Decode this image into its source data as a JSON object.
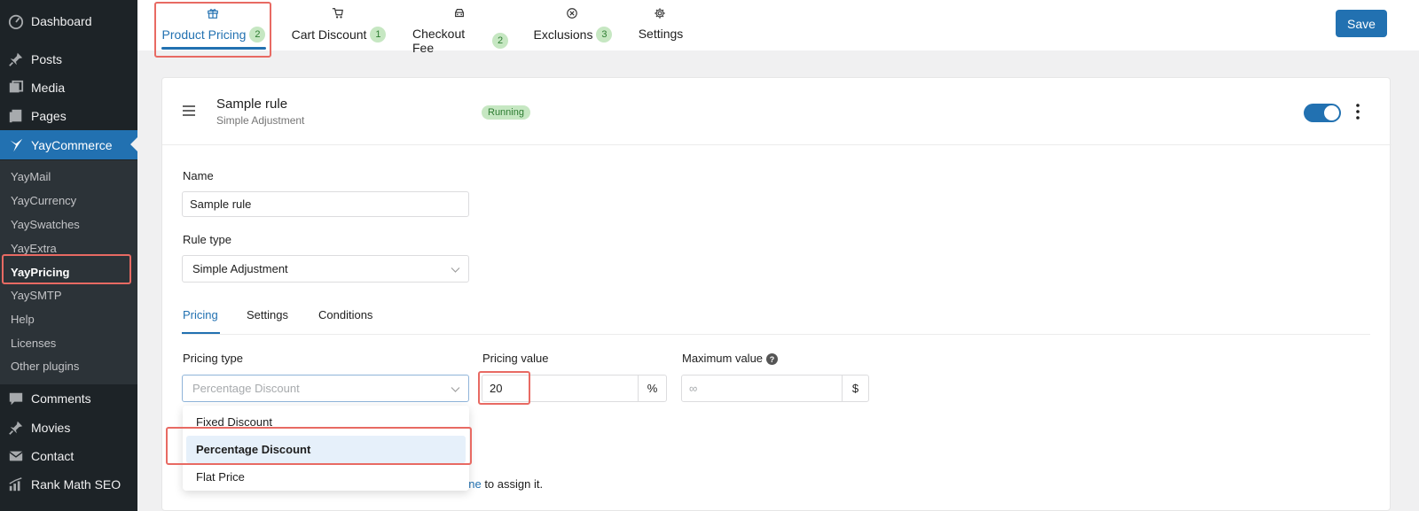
{
  "sidebar": {
    "top_items": [
      {
        "label": "Dashboard",
        "icon": "dashboard-icon"
      },
      {
        "label": "Posts",
        "icon": "pin-icon"
      },
      {
        "label": "Media",
        "icon": "media-icon"
      },
      {
        "label": "Pages",
        "icon": "pages-icon"
      },
      {
        "label": "YayCommerce",
        "icon": "yaycommerce-icon"
      }
    ],
    "submenu": [
      "YayMail",
      "YayCurrency",
      "YaySwatches",
      "YayExtra",
      "YayPricing",
      "YaySMTP",
      "Help",
      "Licenses",
      "Other plugins"
    ],
    "bottom_items": [
      {
        "label": "Comments",
        "icon": "comments-icon"
      },
      {
        "label": "Movies",
        "icon": "pin-icon"
      },
      {
        "label": "Contact",
        "icon": "mail-icon"
      },
      {
        "label": "Rank Math SEO",
        "icon": "chart-icon"
      }
    ]
  },
  "topbar": {
    "tabs": [
      {
        "label": "Product Pricing",
        "badge": "2",
        "icon": "gift-icon"
      },
      {
        "label": "Cart Discount",
        "badge": "1",
        "icon": "cart-icon"
      },
      {
        "label": "Checkout Fee",
        "badge": "2",
        "icon": "car-icon"
      },
      {
        "label": "Exclusions",
        "badge": "3",
        "icon": "x-circle-icon"
      },
      {
        "label": "Settings",
        "badge": "",
        "icon": "gear-icon"
      }
    ],
    "save_label": "Save"
  },
  "rule": {
    "title": "Sample rule",
    "subtitle": "Simple Adjustment",
    "status": "Running",
    "enabled": true
  },
  "form": {
    "name_label": "Name",
    "name_value": "Sample rule",
    "rule_type_label": "Rule type",
    "rule_type_value": "Simple Adjustment",
    "inner_tabs": [
      "Pricing",
      "Settings",
      "Conditions"
    ],
    "pricing_type_label": "Pricing type",
    "pricing_type_placeholder": "Percentage Discount",
    "pricing_value_label": "Pricing value",
    "pricing_value": "20",
    "pricing_unit": "%",
    "max_value_label": "Maximum value",
    "max_value_placeholder": "∞",
    "max_unit": "$",
    "help_glyph": "?",
    "dropdown_options": [
      "Fixed Discount",
      "Percentage Discount",
      "Flat Price"
    ],
    "assign_link": "one",
    "assign_rest": " to assign it."
  },
  "colors": {
    "accent": "#2271b1",
    "sidebar_bg": "#1d2327",
    "badge_bg": "#c6e7c2",
    "highlight": "#e86a63"
  }
}
